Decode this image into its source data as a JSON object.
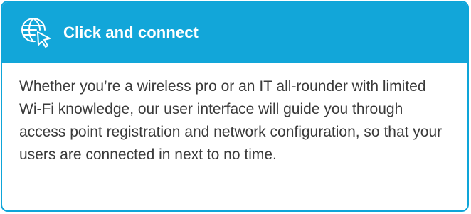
{
  "card": {
    "title": "Click and connect",
    "icon": "globe-cursor-icon",
    "body": "Whether you’re a wireless pro or an IT all-rounder with limited Wi-Fi knowledge, our user interface will guide you through access point registration and network configuration, so that your users are connected in next to no time."
  },
  "colors": {
    "header_bg": "#12a6d9",
    "border": "#0ea5d9",
    "title_text": "#ffffff",
    "body_text": "#3a3a3a"
  }
}
